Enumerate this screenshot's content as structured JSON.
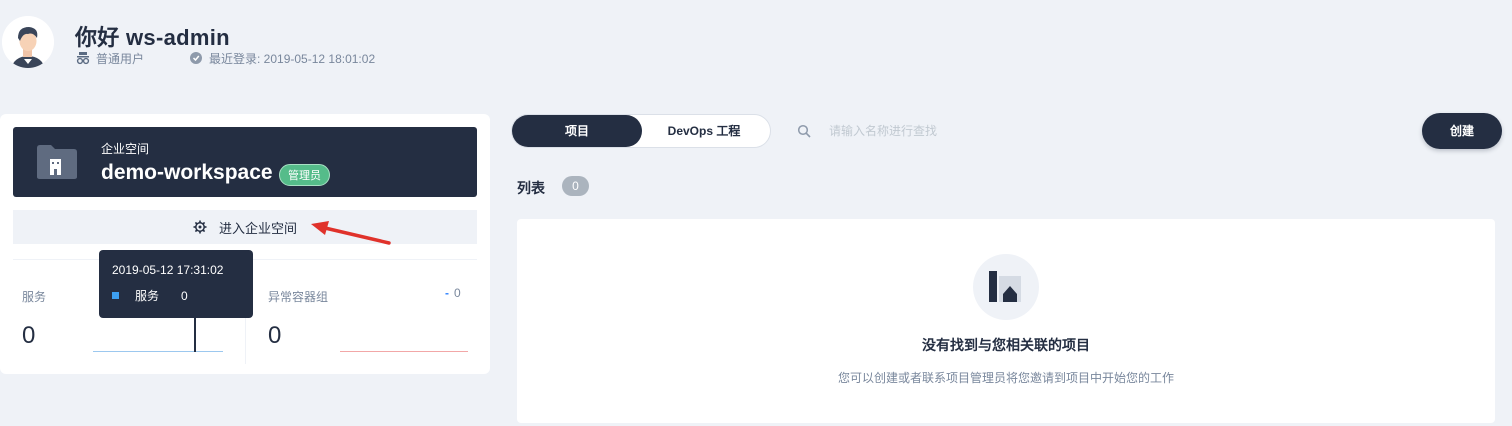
{
  "user": {
    "greeting": "你好 ws-admin",
    "role": "普通用户",
    "last_login": "最近登录: 2019-05-12 18:01:02"
  },
  "workspace": {
    "label": "企业空间",
    "name": "demo-workspace",
    "badge": "管理员",
    "enter_label": "进入企业空间"
  },
  "stats": {
    "services": {
      "label": "服务",
      "value": "0"
    },
    "abnormal_pods": {
      "label": "异常容器组",
      "value": "0",
      "delta": "0"
    }
  },
  "tooltip": {
    "time": "2019-05-12 17:31:02",
    "series": "服务",
    "value": "0"
  },
  "tabs": [
    {
      "label": "项目",
      "active": true
    },
    {
      "label": "DevOps 工程",
      "active": false
    }
  ],
  "search": {
    "placeholder": "请输入名称进行查找"
  },
  "create_button": "创建",
  "list": {
    "title": "列表",
    "count": "0"
  },
  "empty": {
    "title": "没有找到与您相关联的项目",
    "description": "您可以创建或者联系项目管理员将您邀请到项目中开始您的工作"
  },
  "colors": {
    "dark": "#242e42",
    "green": "#55bc8a",
    "blue": "#3d9ff0",
    "red_arrow": "#e0322b",
    "bg": "#eff2f7"
  }
}
